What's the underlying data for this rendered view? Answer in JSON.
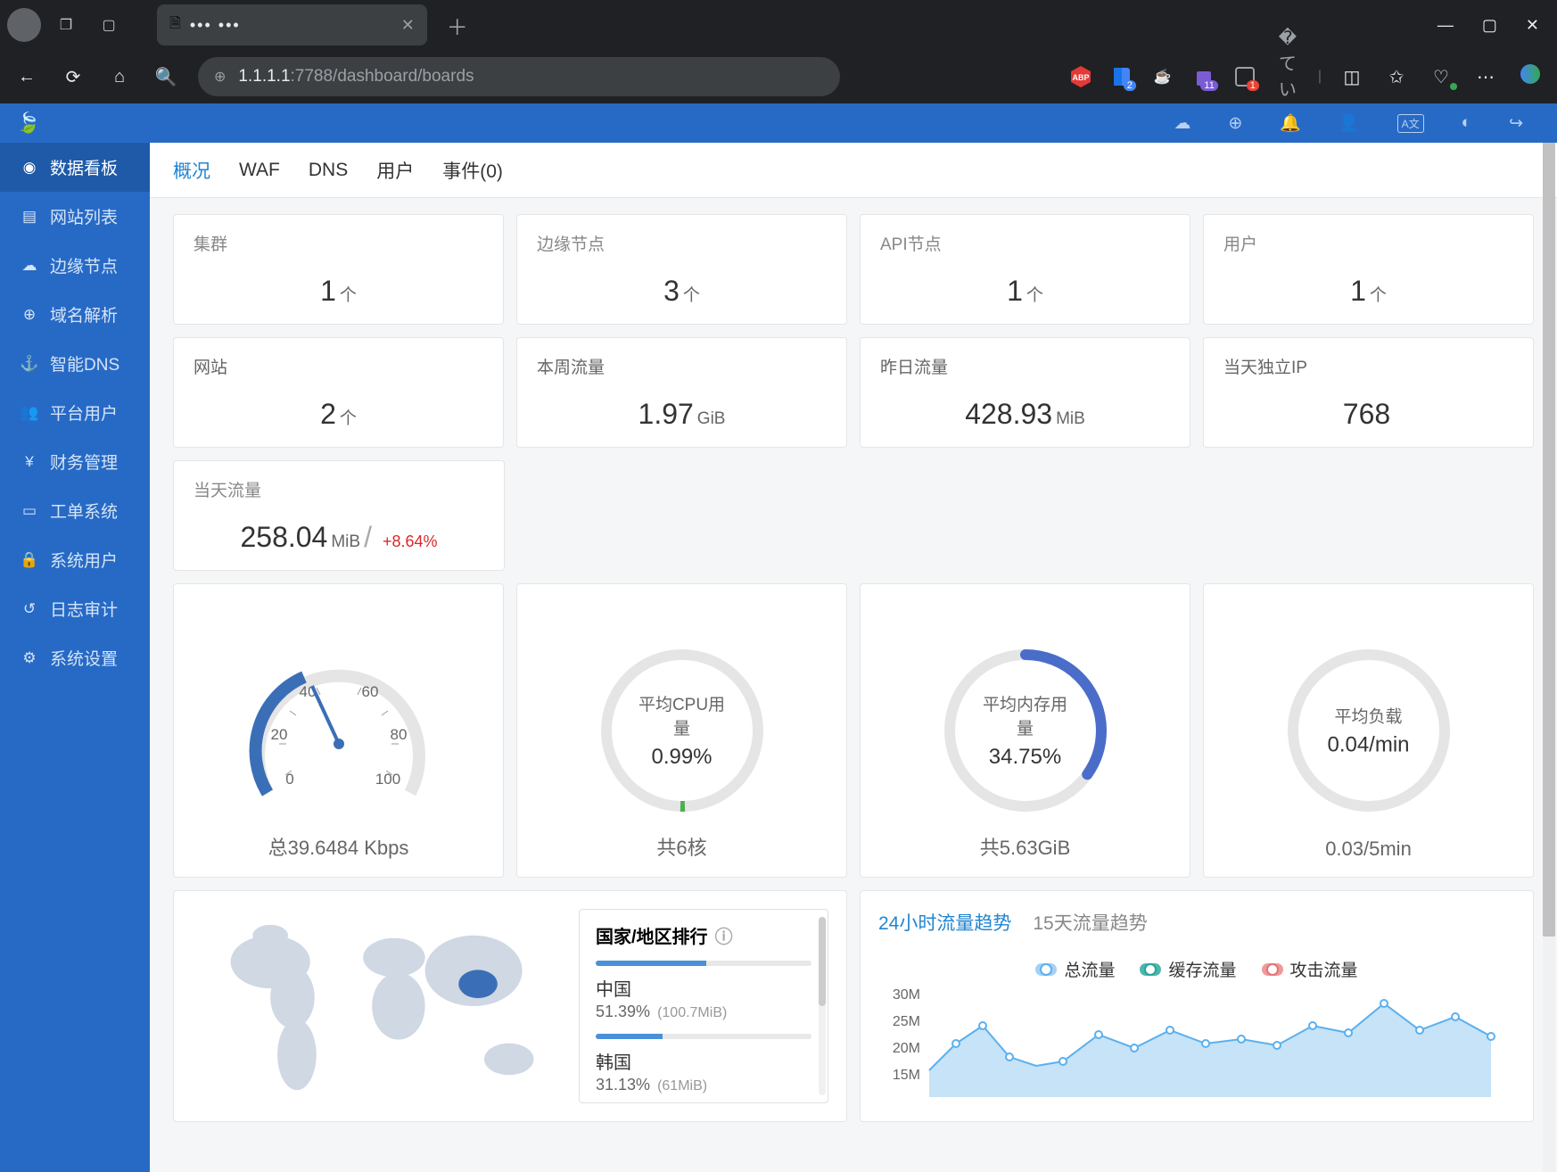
{
  "browser": {
    "url_prefix": "1.1.1.1",
    "url_path": ":7788/dashboard/boards",
    "tab_title": "•••  •••",
    "badge2": "2",
    "badge11": "11",
    "badge1": "1"
  },
  "sidebar": {
    "items": [
      {
        "icon": "◉",
        "label": "数据看板"
      },
      {
        "icon": "▤",
        "label": "网站列表"
      },
      {
        "icon": "☁",
        "label": "边缘节点"
      },
      {
        "icon": "⊕",
        "label": "域名解析"
      },
      {
        "icon": "⚓",
        "label": "智能DNS"
      },
      {
        "icon": "👥",
        "label": "平台用户"
      },
      {
        "icon": "¥",
        "label": "财务管理"
      },
      {
        "icon": "▭",
        "label": "工单系统"
      },
      {
        "icon": "🔒",
        "label": "系统用户"
      },
      {
        "icon": "↺",
        "label": "日志审计"
      },
      {
        "icon": "⚙",
        "label": "系统设置"
      }
    ]
  },
  "tabs": {
    "overview": "概况",
    "waf": "WAF",
    "dns": "DNS",
    "users": "用户",
    "events": "事件(0)"
  },
  "stats1": [
    {
      "label": "集群",
      "value": "1",
      "unit": "个"
    },
    {
      "label": "边缘节点",
      "value": "3",
      "unit": "个"
    },
    {
      "label": "API节点",
      "value": "1",
      "unit": "个"
    },
    {
      "label": "用户",
      "value": "1",
      "unit": "个"
    }
  ],
  "stats2": [
    {
      "label": "网站",
      "value": "2",
      "unit": "个"
    },
    {
      "label": "本周流量",
      "value": "1.97",
      "unit": "GiB"
    },
    {
      "label": "昨日流量",
      "value": "428.93",
      "unit": "MiB"
    },
    {
      "label": "当天独立IP",
      "value": "768",
      "unit": ""
    }
  ],
  "today_traffic": {
    "label": "当天流量",
    "value": "258.04",
    "unit": "MiB",
    "delta": "+8.64%"
  },
  "gauges": {
    "speed": {
      "footer": "总39.6484 Kbps",
      "ticks": [
        "0",
        "20",
        "40",
        "60",
        "80",
        "100"
      ]
    },
    "cpu": {
      "label": "平均CPU用量",
      "value": "0.99%",
      "footer": "共6核"
    },
    "mem": {
      "label": "平均内存用量",
      "value": "34.75%",
      "footer": "共5.63GiB"
    },
    "load": {
      "label": "平均负载",
      "value": "0.04/min",
      "footer": "0.03/5min"
    }
  },
  "ranking": {
    "title": "国家/地区排行",
    "items": [
      {
        "name": "中国",
        "pct": "51.39%",
        "size": "(100.7MiB)",
        "fill": 51.39
      },
      {
        "name": "韩国",
        "pct": "31.13%",
        "size": "(61MiB)",
        "fill": 31.13
      }
    ]
  },
  "chart_tabs": {
    "h24": "24小时流量趋势",
    "d15": "15天流量趋势"
  },
  "legend": {
    "total": "总流量",
    "cache": "缓存流量",
    "attack": "攻击流量"
  },
  "chart_data": {
    "type": "area",
    "ylabel": "",
    "yticks": [
      "15M",
      "20M",
      "25M",
      "30M"
    ],
    "series": [
      {
        "name": "总流量"
      }
    ]
  }
}
